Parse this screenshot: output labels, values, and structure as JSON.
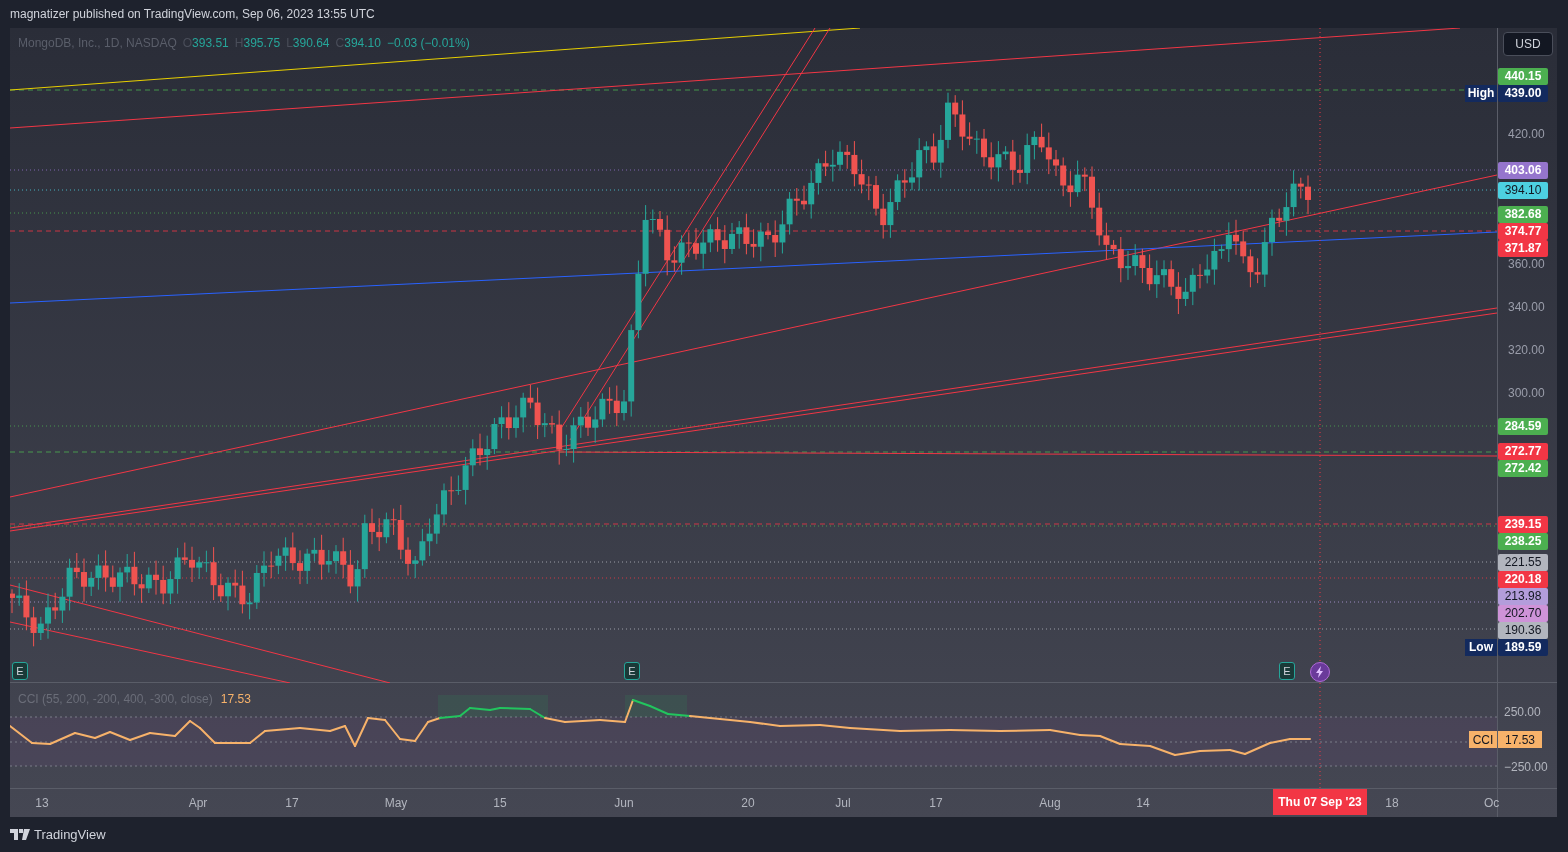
{
  "header": {
    "text": "magnatizer published on TradingView.com, Sep 06, 2023 13:55 UTC"
  },
  "legend": {
    "symbol": "MongoDB, Inc., 1D, NASDAQ",
    "values": [
      {
        "key": "O",
        "value": "393.51"
      },
      {
        "key": "H",
        "value": "395.75"
      },
      {
        "key": "L",
        "value": "390.64"
      },
      {
        "key": "C",
        "value": "394.10"
      }
    ],
    "change": "−0.03 (−0.01%)"
  },
  "currency": "USD",
  "price_ticks": [
    "420.00",
    "360.00",
    "340.00",
    "320.00",
    "300.00"
  ],
  "price_labels": [
    {
      "text": "440.15",
      "color": "#4caf50"
    },
    {
      "title": "High",
      "text": "439.00",
      "color": "#132a5e"
    },
    {
      "text": "403.06",
      "color": "#9575cd"
    },
    {
      "text": "394.10",
      "color": "#4dd0e1"
    },
    {
      "text": "382.68",
      "color": "#4caf50"
    },
    {
      "text": "374.77",
      "color": "#f23645"
    },
    {
      "text": "371.87",
      "color": "#f23645"
    },
    {
      "text": "284.59",
      "color": "#4caf50"
    },
    {
      "text": "272.77",
      "color": "#f23645"
    },
    {
      "text": "272.42",
      "color": "#4caf50"
    },
    {
      "text": "239.15",
      "color": "#f23645"
    },
    {
      "text": "238.25",
      "color": "#4caf50"
    },
    {
      "text": "221.55",
      "color": "#b2b5be"
    },
    {
      "text": "220.18",
      "color": "#f23645"
    },
    {
      "text": "213.98",
      "color": "#b39ddb"
    },
    {
      "text": "202.70",
      "color": "#ce93d8"
    },
    {
      "text": "190.36",
      "color": "#b2b5be"
    },
    {
      "title": "Low",
      "text": "189.59",
      "color": "#132a5e"
    }
  ],
  "events": [
    {
      "kind": "earnings",
      "label": "E"
    },
    {
      "kind": "earnings",
      "label": "E"
    },
    {
      "kind": "earnings",
      "label": "E"
    },
    {
      "kind": "split"
    }
  ],
  "cci": {
    "legend": "CCI (55, 200, -200, 400, -300, close)",
    "value": "17.53",
    "ticks": [
      "250.00",
      "−250.00"
    ],
    "label": "CCI",
    "label_value": "17.53"
  },
  "time_axis": [
    "13",
    "Apr",
    "17",
    "May",
    "15",
    "Jun",
    "20",
    "Jul",
    "17",
    "Aug",
    "14",
    "18",
    "Oc"
  ],
  "date_marker": "Thu 07 Sep '23",
  "footer": {
    "brand": "TradingView"
  }
}
